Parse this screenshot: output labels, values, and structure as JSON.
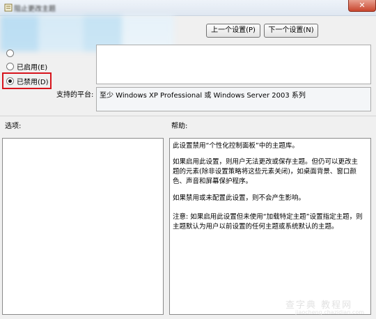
{
  "window": {
    "title": "阻止更改主题",
    "close_glyph": "✕"
  },
  "nav": {
    "prev_label": "上一个设置(P)",
    "next_label": "下一个设置(N)"
  },
  "state": {
    "not_configured_label": "",
    "enabled_label": "已启用(E)",
    "disabled_label": "已禁用(D)",
    "selected": "disabled"
  },
  "platform": {
    "label": "支持的平台:",
    "value": "至少 Windows XP Professional 或 Windows Server 2003 系列"
  },
  "options": {
    "label": "选项:"
  },
  "help": {
    "label": "帮助:",
    "paragraphs": [
      "此设置禁用“个性化控制面板”中的主题库。",
      "如果启用此设置，则用户无法更改或保存主题。但仍可以更改主题的元素(除非设置策略将这些元素关闭)，如桌面背景、窗口颜色、声音和屏幕保护程序。",
      "如果禁用或未配置此设置，则不会产生影响。",
      "注意: 如果启用此设置但未使用“加载特定主题”设置指定主题，则主题默认为用户以前设置的任何主题或系统默认的主题。"
    ]
  },
  "watermark": {
    "text": "查字典 教程网",
    "url": "jiaocheng.chazidian.com"
  },
  "colors": {
    "highlight_border": "#d7141c",
    "window_bg": "#f0f0f0"
  }
}
